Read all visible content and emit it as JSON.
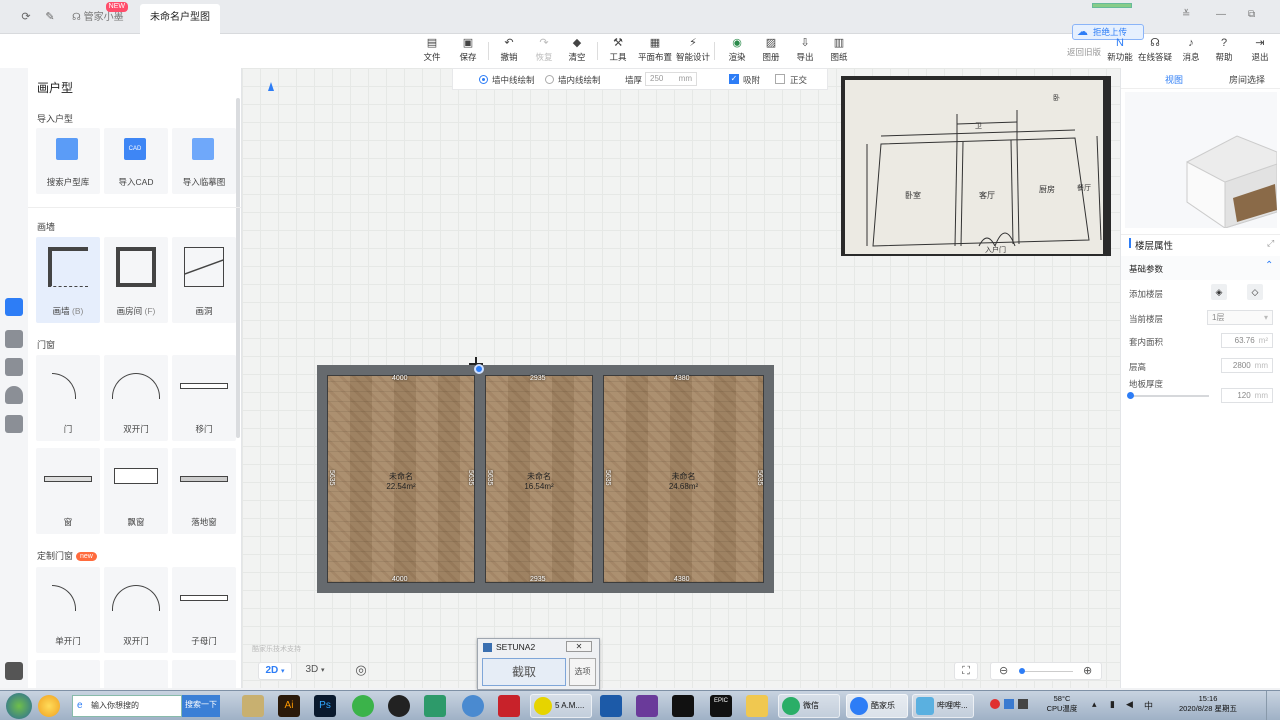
{
  "titlebar": {
    "tabs": [
      {
        "label": "管家小墨",
        "badge": "NEW"
      },
      {
        "label": "未命名户型图"
      }
    ],
    "close_glyph": "×",
    "win_controls": [
      "≚",
      "—",
      "⧉"
    ]
  },
  "toolbar": {
    "items": [
      {
        "label": "文件",
        "icon": "file-icon"
      },
      {
        "label": "保存",
        "icon": "save-icon"
      },
      {
        "label": "撤销",
        "icon": "undo-icon"
      },
      {
        "label": "恢复",
        "icon": "redo-icon"
      },
      {
        "label": "清空",
        "icon": "clear-icon"
      },
      {
        "label": "工具",
        "icon": "tool-icon"
      },
      {
        "label": "平面布置",
        "icon": "layout-icon"
      },
      {
        "label": "智能设计",
        "icon": "smart-icon"
      },
      {
        "label": "渲染",
        "icon": "render-icon"
      },
      {
        "label": "图册",
        "icon": "album-icon"
      },
      {
        "label": "导出",
        "icon": "export-icon"
      },
      {
        "label": "图纸",
        "icon": "drawing-icon"
      }
    ],
    "right_items": [
      {
        "label": "返回旧版"
      },
      {
        "label": "新功能",
        "icon": "new-feature-icon"
      },
      {
        "label": "在线答疑",
        "icon": "headset-icon"
      },
      {
        "label": "消息",
        "icon": "bell-icon"
      },
      {
        "label": "帮助",
        "icon": "help-icon"
      },
      {
        "label": "退出",
        "icon": "exit-icon"
      }
    ],
    "cloud_button": "拒绝上传"
  },
  "left_panel": {
    "title": "画户型",
    "sections": {
      "import": {
        "title": "导入户型",
        "items": [
          "搜索户型库",
          "导入CAD",
          "导入临摹图"
        ]
      },
      "walls": {
        "title": "画墙",
        "items": [
          {
            "label": "画墙",
            "key": "(B)"
          },
          {
            "label": "画房间",
            "key": "(F)"
          },
          {
            "label": "画洞",
            "key": ""
          }
        ]
      },
      "doors": {
        "title": "门窗",
        "items": [
          "门",
          "双开门",
          "移门",
          "窗",
          "飘窗",
          "落地窗"
        ]
      },
      "custom": {
        "title": "定制门窗",
        "badge": "new",
        "items": [
          "单开门",
          "双开门",
          "子母门"
        ]
      }
    }
  },
  "draw_options": {
    "center_line": "墙中线绘制",
    "inner_line": "墙内线绘制",
    "wall_thickness_label": "墙厚",
    "wall_thickness_value": "250",
    "wall_thickness_unit": "mm",
    "snap_label": "吸附",
    "ortho_label": "正交"
  },
  "plan": {
    "rooms": [
      {
        "name": "未命名",
        "area": "22.54m²",
        "top_dim": "4000",
        "bottom_dim": "4000",
        "left_dim": "5635",
        "right_dim": "5635"
      },
      {
        "name": "未命名",
        "area": "16.54m²",
        "top_dim": "2935",
        "bottom_dim": "2935",
        "left_dim": "5635",
        "right_dim": ""
      },
      {
        "name": "未命名",
        "area": "24.68m²",
        "top_dim": "4380",
        "bottom_dim": "4380",
        "left_dim": "5635",
        "right_dim": "5635"
      }
    ]
  },
  "sketch": {
    "labels": [
      "卧室",
      "客厅",
      "厨房",
      "卫",
      "餐厅",
      "入户门",
      "卧"
    ]
  },
  "right_panel": {
    "tabs": [
      "视图",
      "房间选择"
    ],
    "floor_props_title": "楼层属性",
    "basic_params": "基础参数",
    "add_floor": "添加楼层",
    "current_floor": "当前楼层",
    "current_floor_value": "1层",
    "inner_area": "套内面积",
    "inner_area_value": "63.76",
    "inner_area_unit": "m²",
    "floor_height": "层高",
    "floor_height_value": "2800",
    "floor_height_unit": "mm",
    "slab_thickness": "地板厚度",
    "slab_thickness_value": "120",
    "slab_thickness_unit": "mm"
  },
  "bottom": {
    "view_2d": "2D",
    "view_3d": "3D",
    "watermark": "酷家乐技术支持"
  },
  "setuna": {
    "title": "SETUNA2",
    "capture": "截取",
    "options": "选项"
  },
  "taskbar": {
    "search_placeholder": "输入你想搜的",
    "search_button": "搜索一下",
    "apps": [
      {
        "label": "5 A.M...."
      },
      {
        "label": "微信"
      },
      {
        "label": "酷家乐"
      },
      {
        "label": "哔哩哔..."
      }
    ],
    "cpu_temp": "58°C",
    "cpu_label": "CPU温度",
    "time": "15:16",
    "date": "2020/8/28 星期五"
  }
}
